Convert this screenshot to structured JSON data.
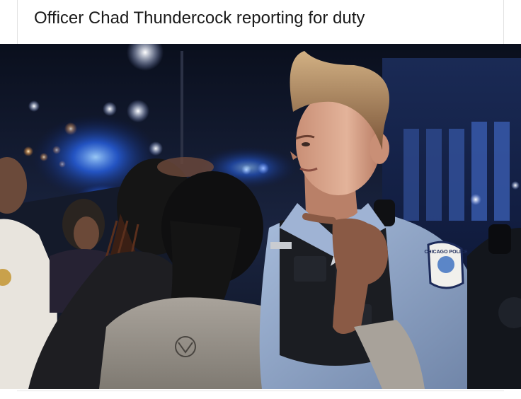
{
  "post": {
    "caption": "Officer Chad Thundercock reporting for duty"
  },
  "photo": {
    "badge_text": "CHICAGO POLICE"
  },
  "colors": {
    "night_sky": "#0b1020",
    "siren_blue": "#2a6bff",
    "uniform_light_blue": "#8fa6c9",
    "vest_black": "#1b1d22",
    "hair_blonde": "#b48a5c"
  }
}
